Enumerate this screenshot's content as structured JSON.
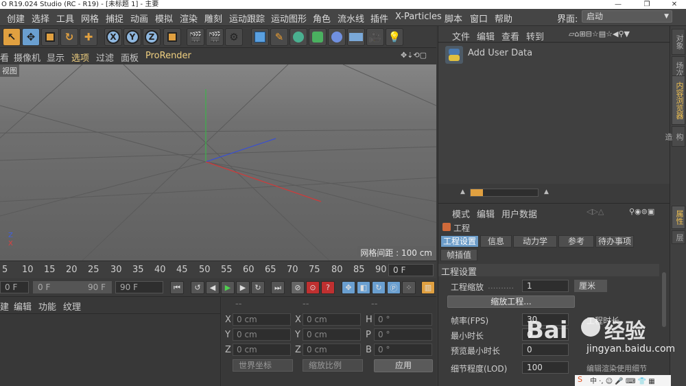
{
  "window": {
    "title": "O R19.024 Studio (RC - R19) - [未标题 1] - 主要",
    "controls": [
      "—",
      "❐",
      "✕"
    ]
  },
  "menubar": {
    "items": [
      "创建",
      "选择",
      "工具",
      "网格",
      "捕捉",
      "动画",
      "模拟",
      "渲染",
      "雕刻",
      "运动跟踪",
      "运动图形",
      "角色",
      "流水线",
      "插件",
      "X-Particles",
      "脚本",
      "窗口",
      "帮助"
    ],
    "layout_label": "界面:",
    "layout_value": "启动"
  },
  "toolbar": {
    "axis_x": "X",
    "axis_y": "Y",
    "axis_z": "Z"
  },
  "viewport_menu": {
    "items": [
      "看",
      "摄像机",
      "显示",
      "选项",
      "过滤",
      "面板",
      "ProRender"
    ]
  },
  "viewport": {
    "label": "视图",
    "grid_readout": "网格间距 : 100 cm",
    "axis_z": "Z",
    "axis_x": "X"
  },
  "timeline": {
    "ticks": [
      "5",
      "10",
      "15",
      "20",
      "25",
      "30",
      "35",
      "40",
      "45",
      "50",
      "55",
      "60",
      "65",
      "70",
      "75",
      "80",
      "85",
      "90"
    ],
    "current_frame": "0 F"
  },
  "transport": {
    "start_frame": "0 F",
    "range_start": "0 F",
    "range_end": "90 F",
    "end_frame": "90 F"
  },
  "material_panel": {
    "menu": [
      "建",
      "编辑",
      "功能",
      "纹理"
    ]
  },
  "coordinates": {
    "header": [
      "--",
      "--",
      "--"
    ],
    "rows": [
      {
        "l1": "X",
        "v1": "0 cm",
        "l2": "X",
        "v2": "0 cm",
        "l3": "H",
        "v3": "0 °"
      },
      {
        "l1": "Y",
        "v1": "0 cm",
        "l2": "Y",
        "v2": "0 cm",
        "l3": "P",
        "v3": "0 °"
      },
      {
        "l1": "Z",
        "v1": "0 cm",
        "l2": "Z",
        "v2": "0 cm",
        "l3": "B",
        "v3": "0 °"
      }
    ],
    "world_coords": "世界坐标",
    "scale_ratio": "缩放比例",
    "apply": "应用"
  },
  "content_browser": {
    "menu": [
      "文件",
      "编辑",
      "查看",
      "转到"
    ],
    "item_label": "Add User Data",
    "slider_fill": 0.18
  },
  "attributes": {
    "menu": [
      "模式",
      "编辑",
      "用户数据"
    ],
    "object_name": "工程",
    "tabs": [
      "工程设置",
      "信息",
      "动力学",
      "参考",
      "待办事项",
      "帧插值"
    ],
    "section_title": "工程设置",
    "scale_label": "工程缩放",
    "scale_value": "1",
    "scale_unit": "厘米",
    "scale_button": "缩放工程...",
    "fps_label": "帧率(FPS)",
    "fps_value": "30",
    "project_length_label": "工程时长",
    "min_length_label": "最小时长",
    "min_length_value": "0",
    "preview_min_label": "预览最小时长",
    "preview_min_value": "0",
    "lod_label": "细节程度(LOD)",
    "lod_value": "100",
    "render_lod_label": "编辑渲染使用细节"
  },
  "side_tabs": [
    "对象",
    "场次",
    "内容浏览器",
    "构造",
    "属性",
    "层"
  ],
  "watermark": {
    "url": "jingyan.baidu.com"
  },
  "colors": {
    "accent_blue": "#6c9cc8",
    "accent_orange": "#e0a040",
    "menu_highlight": "#f0c050"
  }
}
